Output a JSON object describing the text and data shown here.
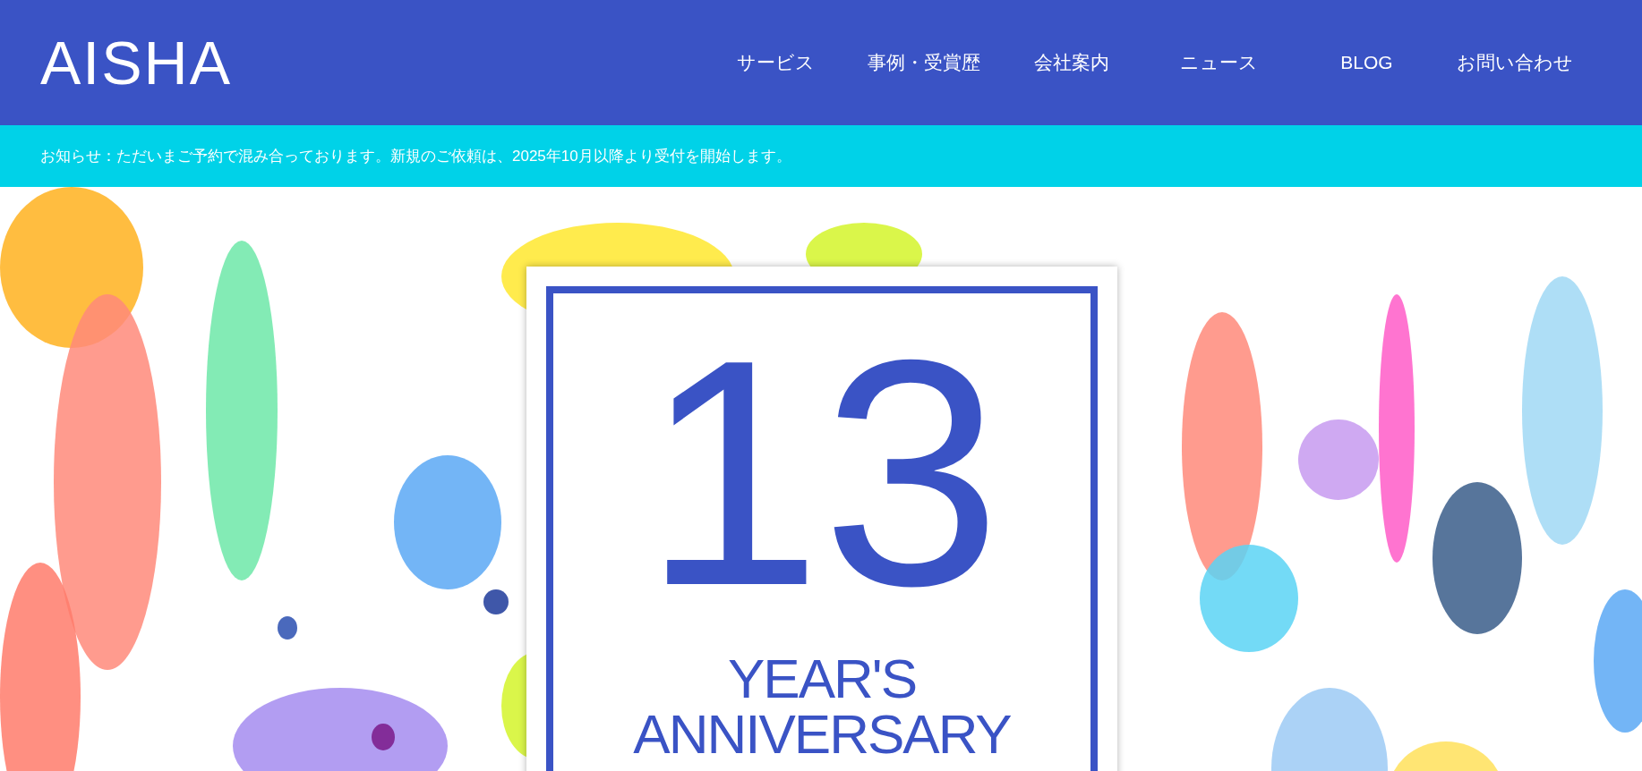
{
  "header": {
    "logo": "AISHA",
    "nav": [
      {
        "label": "サービス"
      },
      {
        "label": "事例・受賞歴"
      },
      {
        "label": "会社案内"
      },
      {
        "label": "ニュース"
      },
      {
        "label": "BLOG"
      },
      {
        "label": "お問い合わせ"
      }
    ]
  },
  "notice": "お知らせ：ただいまご予約で混み合っております。新規のご依頼は、2025年10月以降より受付を開始します。",
  "hero": {
    "number": "13",
    "line_1": "YEAR'S",
    "line_2": "ANNIVERSARY"
  }
}
